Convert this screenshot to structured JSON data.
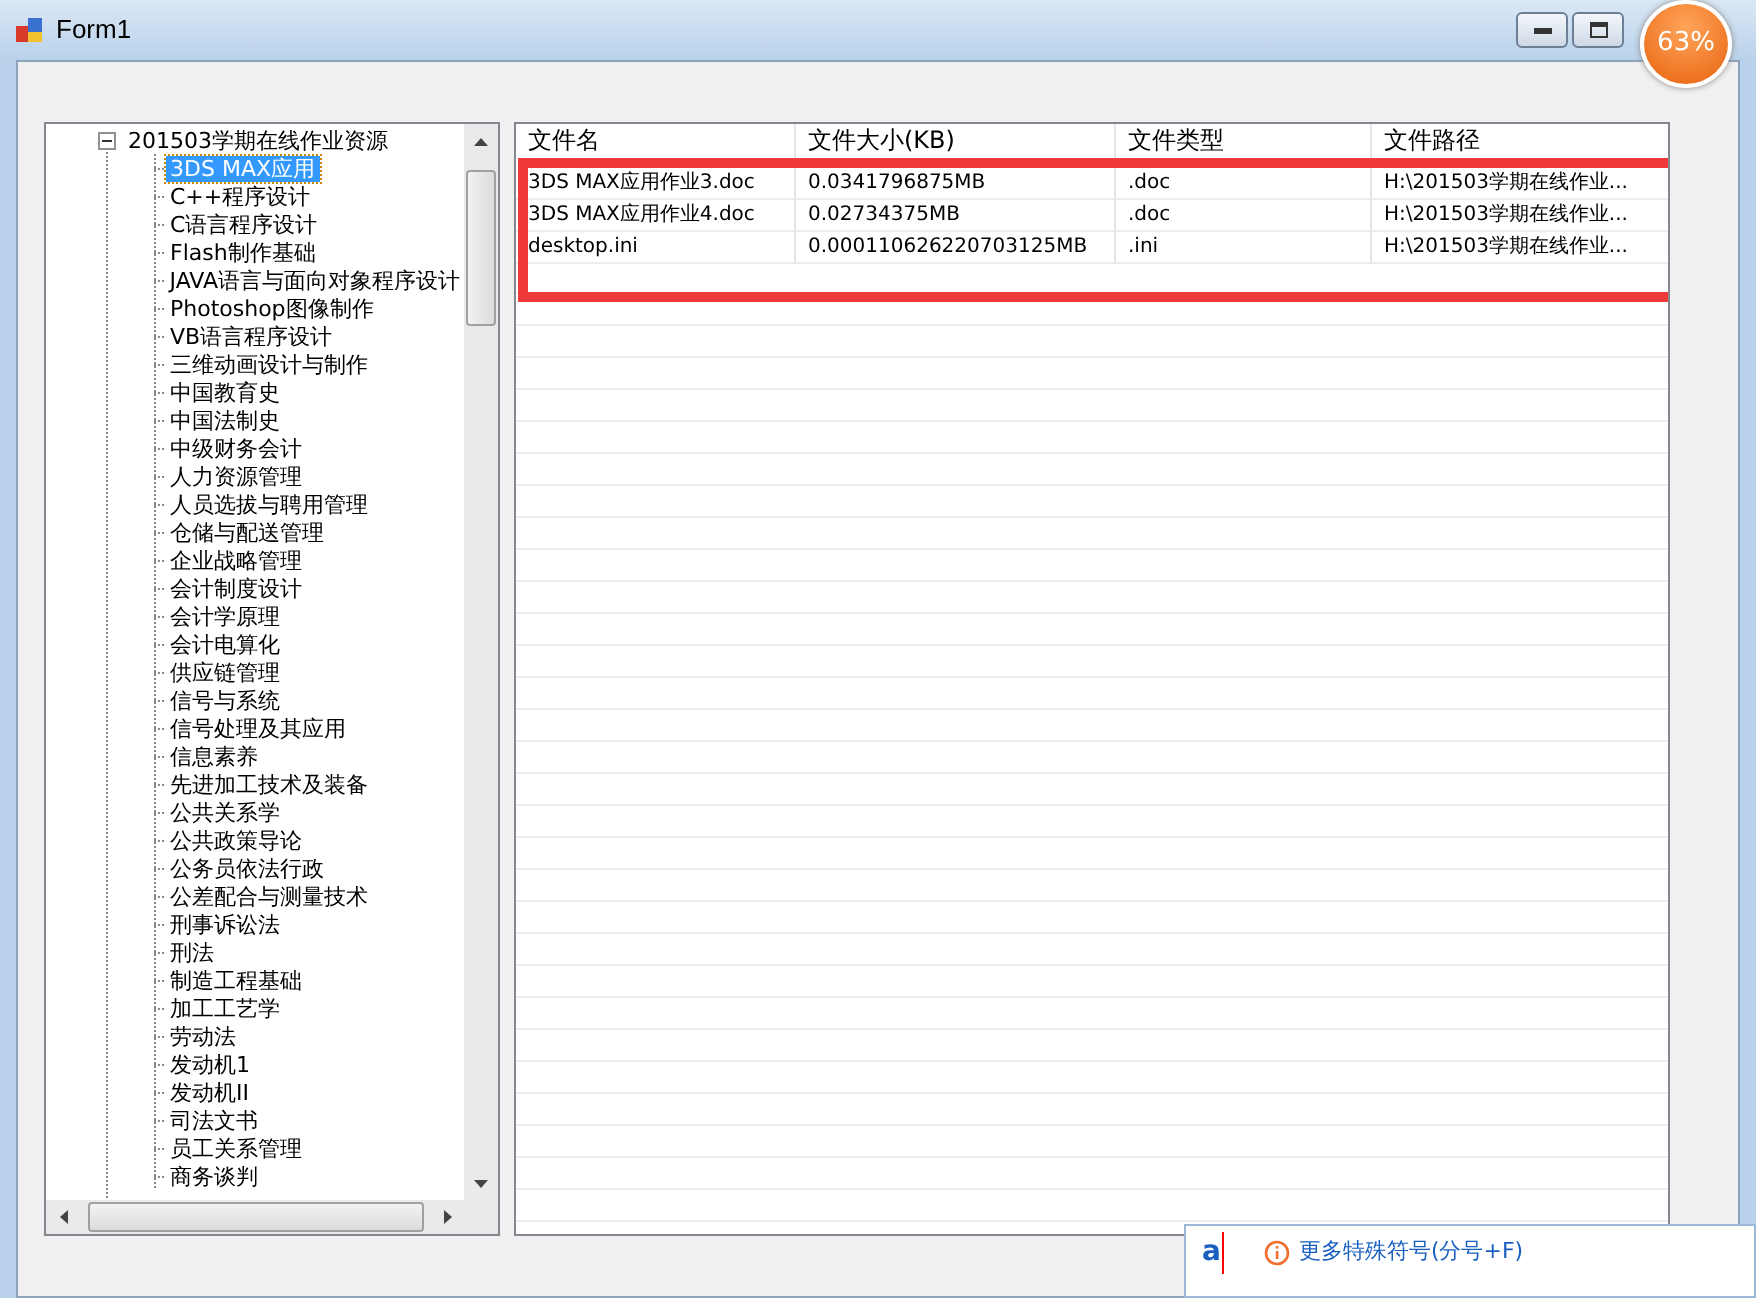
{
  "window": {
    "title": "Form1",
    "controls": [
      {
        "kind": "minimize"
      },
      {
        "kind": "restore"
      }
    ]
  },
  "usage_badge": {
    "text": "63%"
  },
  "tree": {
    "label": "201503学期在线作业资源",
    "expanded": true,
    "children": [
      {
        "label": "3DS MAX应用",
        "selected": true
      },
      {
        "label": "C++程序设计",
        "selected": false
      },
      {
        "label": "C语言程序设计",
        "selected": false
      },
      {
        "label": "Flash制作基础",
        "selected": false
      },
      {
        "label": "JAVA语言与面向对象程序设计",
        "selected": false
      },
      {
        "label": "Photoshop图像制作",
        "selected": false
      },
      {
        "label": "VB语言程序设计",
        "selected": false
      },
      {
        "label": "三维动画设计与制作",
        "selected": false
      },
      {
        "label": "中国教育史",
        "selected": false
      },
      {
        "label": "中国法制史",
        "selected": false
      },
      {
        "label": "中级财务会计",
        "selected": false
      },
      {
        "label": "人力资源管理",
        "selected": false
      },
      {
        "label": "人员选拔与聘用管理",
        "selected": false
      },
      {
        "label": "仓储与配送管理",
        "selected": false
      },
      {
        "label": "企业战略管理",
        "selected": false
      },
      {
        "label": "会计制度设计",
        "selected": false
      },
      {
        "label": "会计学原理",
        "selected": false
      },
      {
        "label": "会计电算化",
        "selected": false
      },
      {
        "label": "供应链管理",
        "selected": false
      },
      {
        "label": "信号与系统",
        "selected": false
      },
      {
        "label": "信号处理及其应用",
        "selected": false
      },
      {
        "label": "信息素养",
        "selected": false
      },
      {
        "label": "先进加工技术及装备",
        "selected": false
      },
      {
        "label": "公共关系学",
        "selected": false
      },
      {
        "label": "公共政策导论",
        "selected": false
      },
      {
        "label": "公务员依法行政",
        "selected": false
      },
      {
        "label": "公差配合与测量技术",
        "selected": false
      },
      {
        "label": "刑事诉讼法",
        "selected": false
      },
      {
        "label": "刑法",
        "selected": false
      },
      {
        "label": "制造工程基础",
        "selected": false
      },
      {
        "label": "加工工艺学",
        "selected": false
      },
      {
        "label": "劳动法",
        "selected": false
      },
      {
        "label": "发动机1",
        "selected": false
      },
      {
        "label": "发动机II",
        "selected": false
      },
      {
        "label": "司法文书",
        "selected": false
      },
      {
        "label": "员工关系管理",
        "selected": false
      },
      {
        "label": "商务谈判",
        "selected": false
      }
    ]
  },
  "table": {
    "columns": [
      "文件名",
      "文件大小(KB)",
      "文件类型",
      "文件路径"
    ],
    "rows": [
      [
        "3DS MAX应用作业3.doc",
        "0.0341796875MB",
        ".doc",
        "H:\\201503学期在线作业..."
      ],
      [
        "3DS MAX应用作业4.doc",
        "0.02734375MB",
        ".doc",
        "H:\\201503学期在线作业..."
      ],
      [
        "desktop.ini",
        "0.000110626220703125MB",
        ".ini",
        "H:\\201503学期在线作业..."
      ]
    ],
    "highlight": {
      "color": "#f03a3a"
    }
  },
  "ime": {
    "typed": "a",
    "hint": "更多特殊符号(分号+F)"
  }
}
